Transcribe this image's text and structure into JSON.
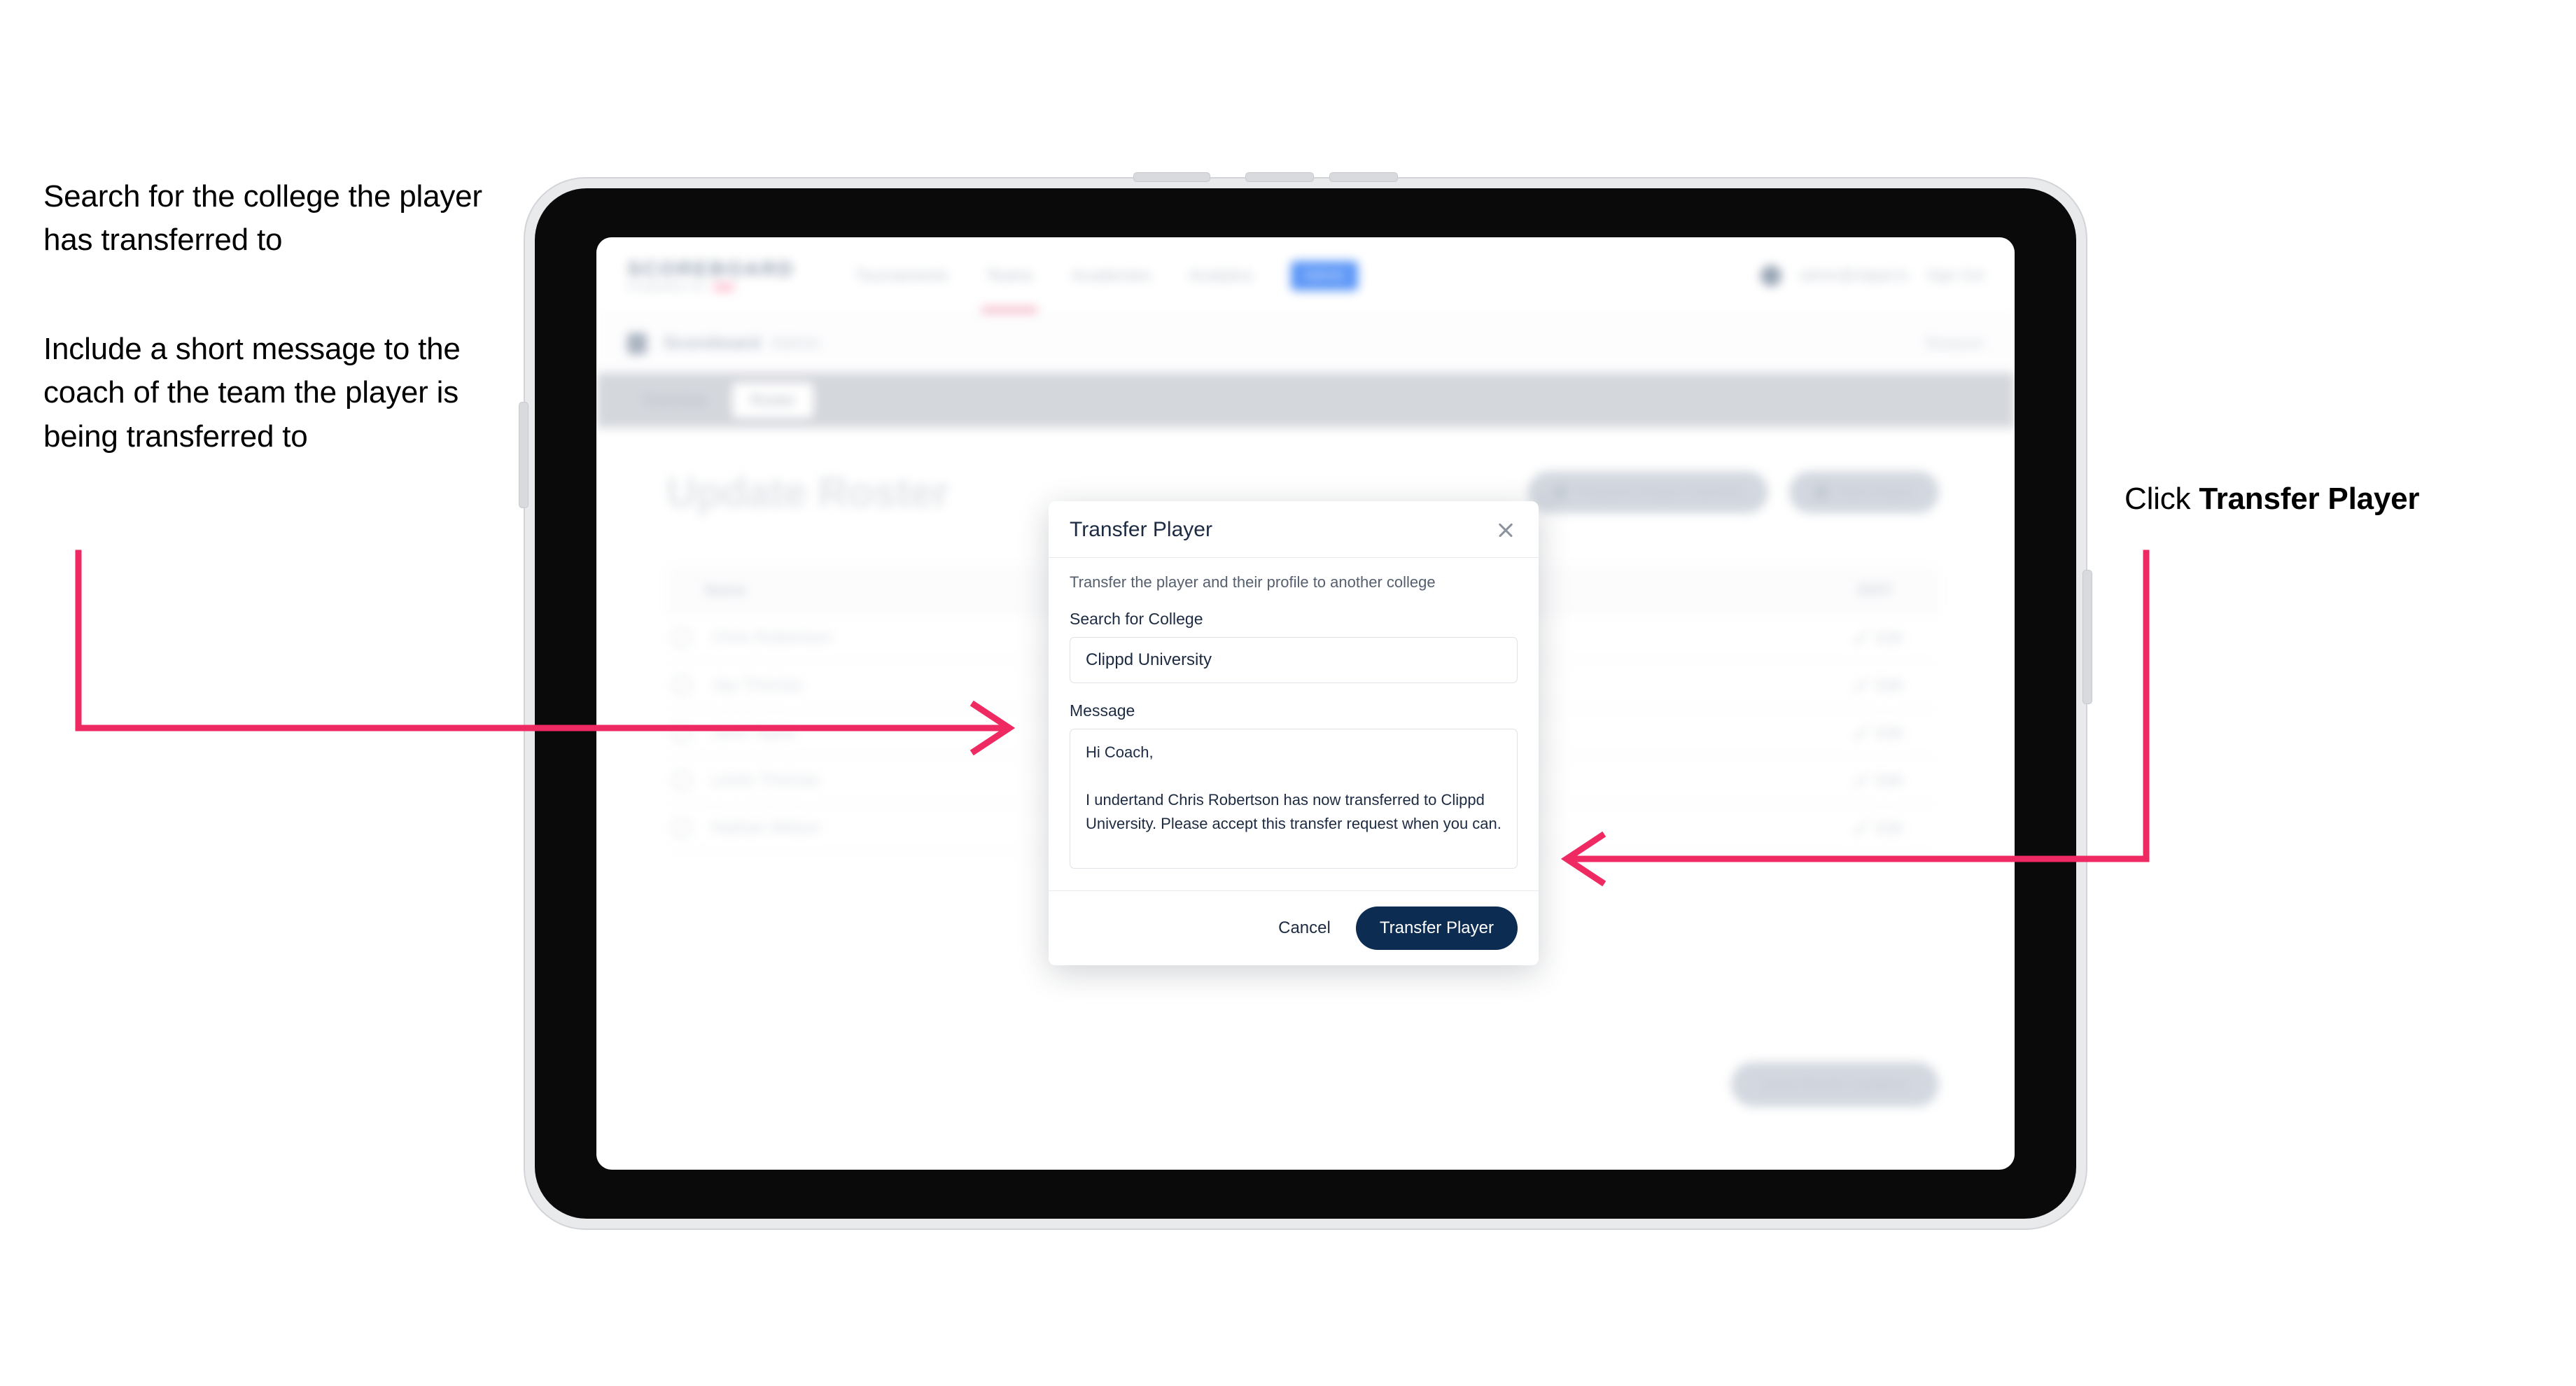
{
  "annotations": {
    "left_1": "Search for the college the player has transferred to",
    "left_2": "Include a short message to the coach of the team the player is being transferred to",
    "right_prefix": "Click ",
    "right_bold": "Transfer Player"
  },
  "colors": {
    "arrow": "#ef2a63",
    "primary_button": "#0d2c51",
    "nav_pill": "#5b96f7",
    "brand_accent": "#ffc9d8"
  },
  "app": {
    "brand": {
      "name": "SCOREBOARD",
      "sub": "POWERED BY",
      "sub_badge": "clippd"
    },
    "nav_links": [
      "Tournaments",
      "Teams",
      "Academies",
      "Analytics"
    ],
    "nav_pill": "Admin",
    "account": {
      "email": "admin@clippd.io",
      "sign_out": "Sign Out"
    },
    "breadcrumb": {
      "main": "Scoreboard",
      "sub": "Admin"
    },
    "season_selector": "Season",
    "tabs": [
      {
        "label": "Overview",
        "active": false
      },
      {
        "label": "Roster",
        "active": true
      }
    ],
    "page_title": "Update Roster",
    "header_actions": [
      "Request Player Transfer",
      "Add Player"
    ],
    "table": {
      "columns": {
        "name": "Name",
        "edit": "EDIT"
      },
      "rows": [
        {
          "name": "Chris Robertson",
          "action": "Edit"
        },
        {
          "name": "Jay Thomas",
          "action": "Edit"
        },
        {
          "name": "John Taylor",
          "action": "Edit"
        },
        {
          "name": "Lewis Thomas",
          "action": "Edit"
        },
        {
          "name": "Nathan Wilson",
          "action": "Edit"
        }
      ]
    },
    "save_button": "Save Roster Updates"
  },
  "modal": {
    "title": "Transfer Player",
    "close_icon": "close-icon",
    "description": "Transfer the player and their profile to another college",
    "college_label": "Search for College",
    "college_value": "Clippd University",
    "college_placeholder": "Search for College",
    "message_label": "Message",
    "message_value": "Hi Coach,\n\nI undertand Chris Robertson has now transferred to Clippd University. Please accept this transfer request when you can.",
    "message_placeholder": "Message",
    "cancel_label": "Cancel",
    "submit_label": "Transfer Player"
  }
}
